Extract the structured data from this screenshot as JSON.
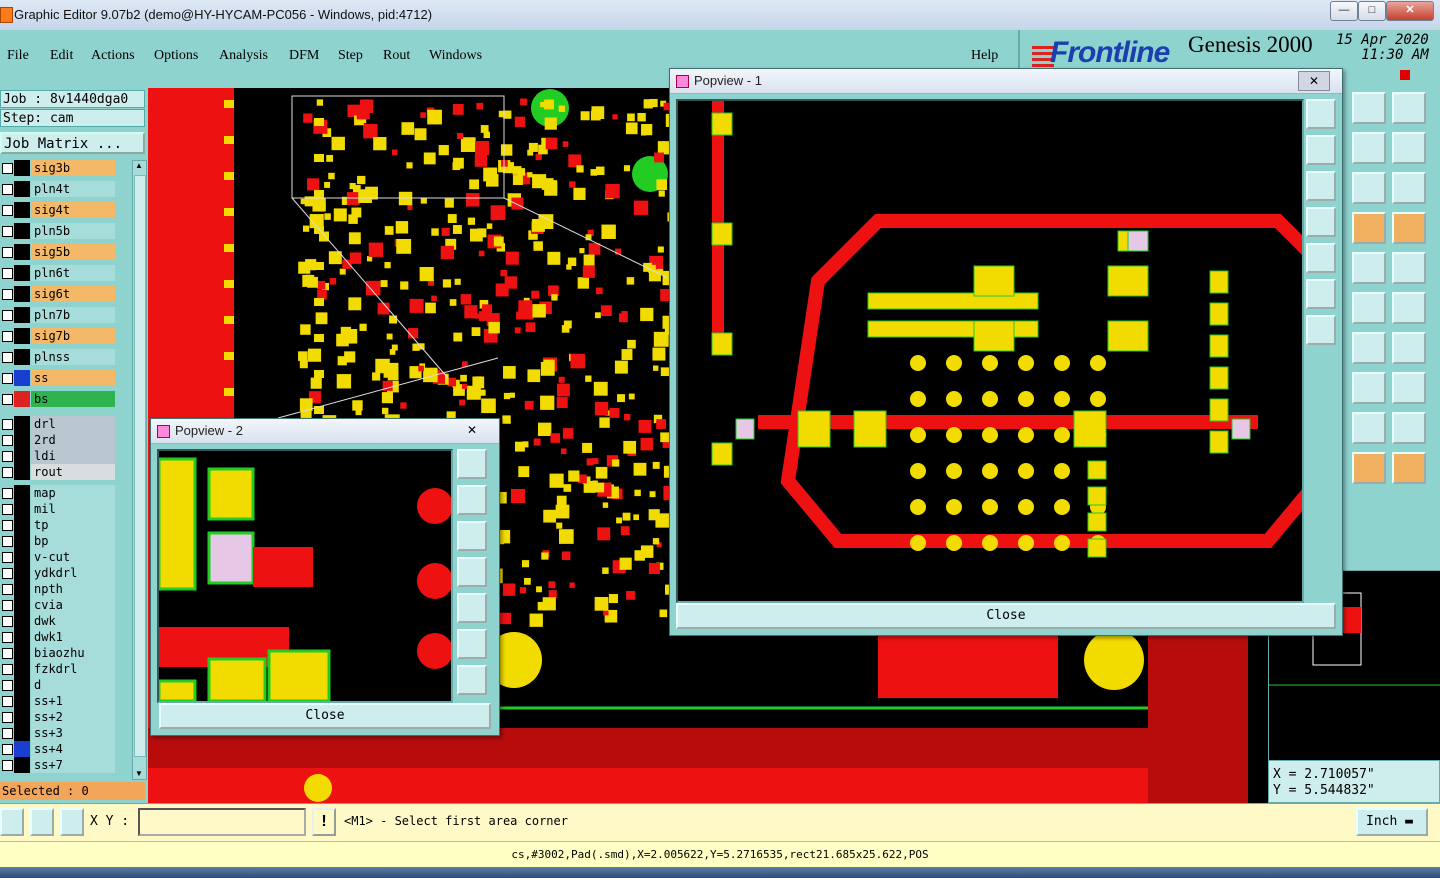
{
  "window": {
    "title": "Graphic Editor 9.07b2 (demo@HY-HYCAM-PC056 - Windows, pid:4712)"
  },
  "menu": {
    "items": [
      "File",
      "Edit",
      "Actions",
      "Options",
      "Analysis",
      "DFM",
      "Step",
      "Rout",
      "Windows"
    ],
    "help": "Help"
  },
  "brand": {
    "logo": "Frontline",
    "product": "Genesis 2000",
    "date": "15 Apr 2020",
    "time": "11:30 AM"
  },
  "job": {
    "job_line": "Job : 8v1440dga0",
    "step_line": "Step: cam",
    "matrix_button": "Job Matrix ...",
    "selected_line": "Selected : 0"
  },
  "layers": [
    {
      "name": "sig3b",
      "color": "#f3b868"
    },
    {
      "name": "pln4t",
      "color": "#a6dcd9"
    },
    {
      "name": "sig4t",
      "color": "#f3b868"
    },
    {
      "name": "pln5b",
      "color": "#a6dcd9"
    },
    {
      "name": "sig5b",
      "color": "#f3b868"
    },
    {
      "name": "pln6t",
      "color": "#a6dcd9"
    },
    {
      "name": "sig6t",
      "color": "#f3b868"
    },
    {
      "name": "pln7b",
      "color": "#a6dcd9"
    },
    {
      "name": "sig7b",
      "color": "#f3b868"
    },
    {
      "name": "plnss",
      "color": "#a6dcd9"
    },
    {
      "name": "ss",
      "color": "#f3b868",
      "sw": "#1a3fd0"
    },
    {
      "name": "bs",
      "color": "#2fb34f",
      "sw": "#d22"
    },
    {
      "name": "drl",
      "color": "#b9c7d0"
    },
    {
      "name": "2rd",
      "color": "#b9c7d0"
    },
    {
      "name": "ldi",
      "color": "#b9c7d0"
    },
    {
      "name": "rout",
      "color": "#d8dde0"
    },
    {
      "name": "map",
      "color": "#a6dcd9"
    },
    {
      "name": "mil",
      "color": "#a6dcd9"
    },
    {
      "name": "tp",
      "color": "#a6dcd9"
    },
    {
      "name": "bp",
      "color": "#a6dcd9"
    },
    {
      "name": "v-cut",
      "color": "#a6dcd9"
    },
    {
      "name": "ydkdrl",
      "color": "#a6dcd9"
    },
    {
      "name": "npth",
      "color": "#a6dcd9"
    },
    {
      "name": "cvia",
      "color": "#a6dcd9"
    },
    {
      "name": "dwk",
      "color": "#a6dcd9"
    },
    {
      "name": "dwk1",
      "color": "#a6dcd9"
    },
    {
      "name": "biaozhu",
      "color": "#a6dcd9"
    },
    {
      "name": "fzkdrl",
      "color": "#a6dcd9"
    },
    {
      "name": "d",
      "color": "#a6dcd9"
    },
    {
      "name": "ss+1",
      "color": "#a6dcd9"
    },
    {
      "name": "ss+2",
      "color": "#a6dcd9"
    },
    {
      "name": "ss+3",
      "color": "#a6dcd9"
    },
    {
      "name": "ss+4",
      "color": "#a6dcd9",
      "sw": "#1a3fd0"
    },
    {
      "name": "ss+7",
      "color": "#a6dcd9"
    }
  ],
  "popup1": {
    "title": "Popview - 1",
    "close_label": "Close"
  },
  "popup2": {
    "title": "Popview - 2",
    "close_label": "Close"
  },
  "coords": {
    "x": "X = 2.710057\"",
    "y": "Y = 5.544832\""
  },
  "command": {
    "xy_label": "X Y :",
    "prompt": "<M1> - Select first area corner",
    "unit": "Inch"
  },
  "status": "cs,#3002,Pad(.smd),X=2.005622,Y=5.2716535,rect21.685x25.622,POS",
  "colors": {
    "trace": "#ee1111",
    "pad": "#f2dc00",
    "outline": "#22cc22",
    "bg": "#000000"
  }
}
